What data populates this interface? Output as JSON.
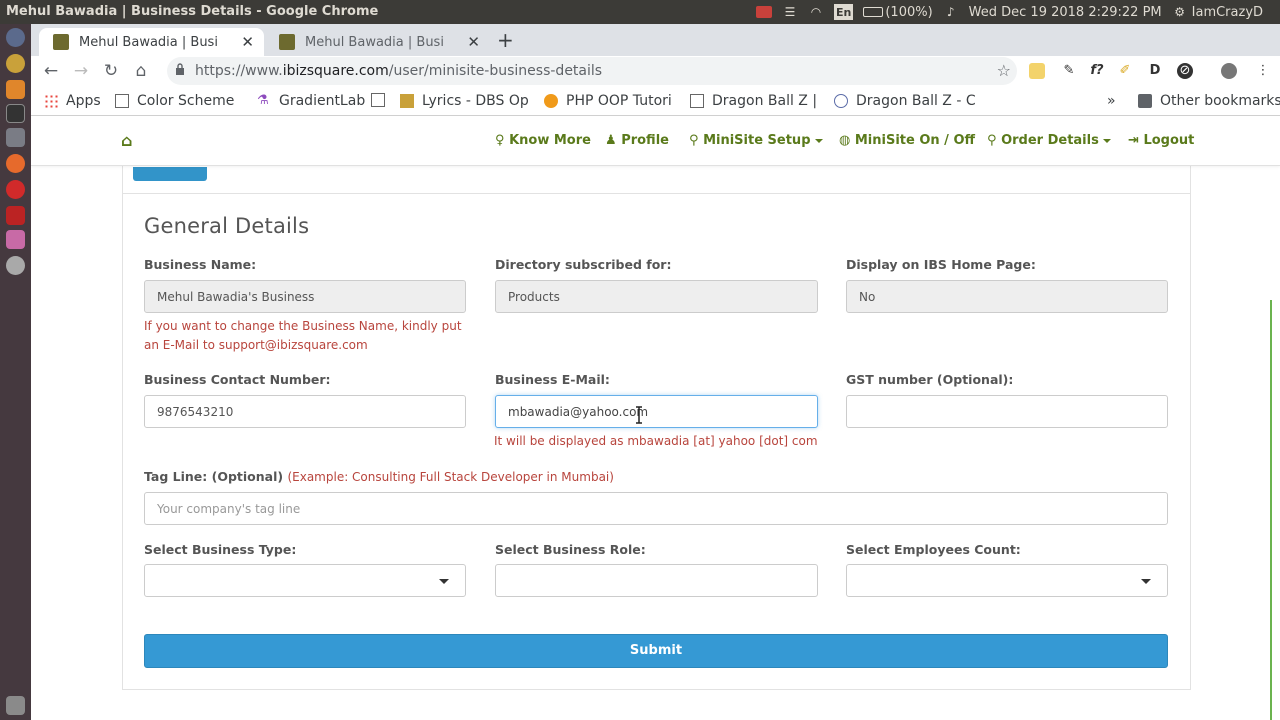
{
  "os": {
    "window_title": "Mehul Bawadia | Business Details - Google Chrome",
    "en": "En",
    "battery": "(100%)",
    "clock": "Wed Dec 19 2018  2:29:22 PM",
    "user": "IamCrazyD"
  },
  "browser": {
    "tabs": [
      {
        "title": "Mehul Bawadia | Business",
        "active": true
      },
      {
        "title": "Mehul Bawadia | Business",
        "active": false
      }
    ],
    "url_prefix": "https://www.",
    "url_domain": "ibizsquare.com",
    "url_path": "/user/minisite-business-details",
    "bookmarks": [
      {
        "label": "Apps",
        "icon": "apps-grid-icon"
      },
      {
        "label": "Color Scheme G",
        "icon": "page-icon"
      },
      {
        "label": "GradientLab",
        "icon": "flask-icon"
      },
      {
        "label": "",
        "icon": "page-icon"
      },
      {
        "label": "Lyrics - DBS Op",
        "icon": "lyrics-icon"
      },
      {
        "label": "PHP OOP Tutori",
        "icon": "info-icon"
      },
      {
        "label": "Dragon Ball Z | W",
        "icon": "page-icon"
      },
      {
        "label": "Dragon Ball Z - C",
        "icon": "shield-icon"
      }
    ],
    "other_bookmarks": "Other bookmarks"
  },
  "nav": {
    "home_icon": "home-icon",
    "items": [
      {
        "label": "Know More",
        "icon": "lightbulb-icon",
        "caret": false
      },
      {
        "label": "Profile",
        "icon": "user-icon",
        "caret": false
      },
      {
        "label": "MiniSite Setup",
        "icon": "link-icon",
        "caret": true
      },
      {
        "label": "MiniSite On / Off",
        "icon": "globe-icon",
        "caret": false
      },
      {
        "label": "Order Details",
        "icon": "link-icon",
        "caret": true
      },
      {
        "label": "Logout",
        "icon": "logout-icon",
        "caret": false
      }
    ]
  },
  "form": {
    "section_title": "General Details",
    "business_name": {
      "label": "Business Name:",
      "value": "Mehul Bawadia's Business",
      "hint": "If you want to change the Business Name, kindly put an E-Mail to support@ibizsquare.com"
    },
    "directory": {
      "label": "Directory subscribed for:",
      "value": "Products"
    },
    "display_home": {
      "label": "Display on IBS Home Page:",
      "value": "No"
    },
    "contact_number": {
      "label": "Business Contact Number:",
      "value": "9876543210"
    },
    "email": {
      "label": "Business E-Mail:",
      "value": "mbawadia@yahoo.com",
      "hint": "It will be displayed as mbawadia [at] yahoo [dot] com"
    },
    "gst": {
      "label": "GST number (Optional):",
      "value": ""
    },
    "tagline": {
      "label": "Tag Line: (Optional)",
      "example": "(Example: Consulting Full Stack Developer in Mumbai)",
      "placeholder": "Your company's tag line"
    },
    "business_type": {
      "label": "Select Business Type:",
      "value": ""
    },
    "business_role": {
      "label": "Select Business Role:",
      "value": ""
    },
    "employees": {
      "label": "Select Employees Count:",
      "value": ""
    },
    "submit_label": "Submit"
  },
  "colors": {
    "nav_green": "#5a7a1b",
    "error_red": "#b8453d",
    "submit_blue": "#3599d4"
  }
}
